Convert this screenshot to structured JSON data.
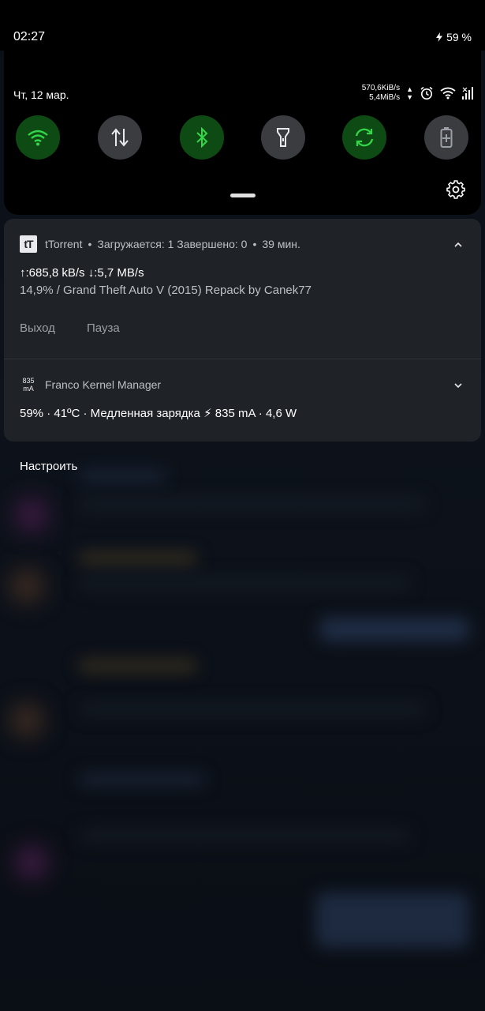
{
  "status_bar": {
    "time": "02:27",
    "battery": "59 %",
    "charging_icon": "lightning-icon"
  },
  "quick_settings": {
    "date": "Чт, 12 мар.",
    "speed_up": "570,6KiB/s",
    "speed_down": "5,4MiB/s",
    "status_icons": [
      "alarm-icon",
      "wifi-icon",
      "signal-icon"
    ],
    "tiles": [
      {
        "name": "wifi-tile",
        "icon": "wifi-icon",
        "state": "on"
      },
      {
        "name": "mobile-data-tile",
        "icon": "data-arrows-icon",
        "state": "off"
      },
      {
        "name": "bluetooth-tile",
        "icon": "bluetooth-icon",
        "state": "on"
      },
      {
        "name": "flashlight-tile",
        "icon": "flashlight-icon",
        "state": "off"
      },
      {
        "name": "auto-rotate-tile",
        "icon": "rotate-icon",
        "state": "on"
      },
      {
        "name": "battery-saver-tile",
        "icon": "battery-saver-icon",
        "state": "off"
      }
    ],
    "accent_on": "#0e4a13",
    "icon_on": "#34d64a"
  },
  "notifications": {
    "ttorrent": {
      "app_icon_text": "tT",
      "app_name": "tTorrent",
      "summary": "Загружается: 1 Завершено: 0",
      "time": "39 мин.",
      "line1": "↑:685,8 kB/s ↓:5,7 MB/s",
      "line2": "14,9% / Grand Theft Auto V (2015) Repack by Canek77",
      "actions": [
        "Выход",
        "Пауза"
      ]
    },
    "franco": {
      "app_icon_text_top": "835",
      "app_icon_text_bottom": "mA",
      "app_name": "Franco Kernel Manager",
      "line": "59% · 41ºC · Медленная зарядка ⚡ 835 mA · 4,6 W"
    }
  },
  "footer": {
    "customize": "Настроить"
  }
}
